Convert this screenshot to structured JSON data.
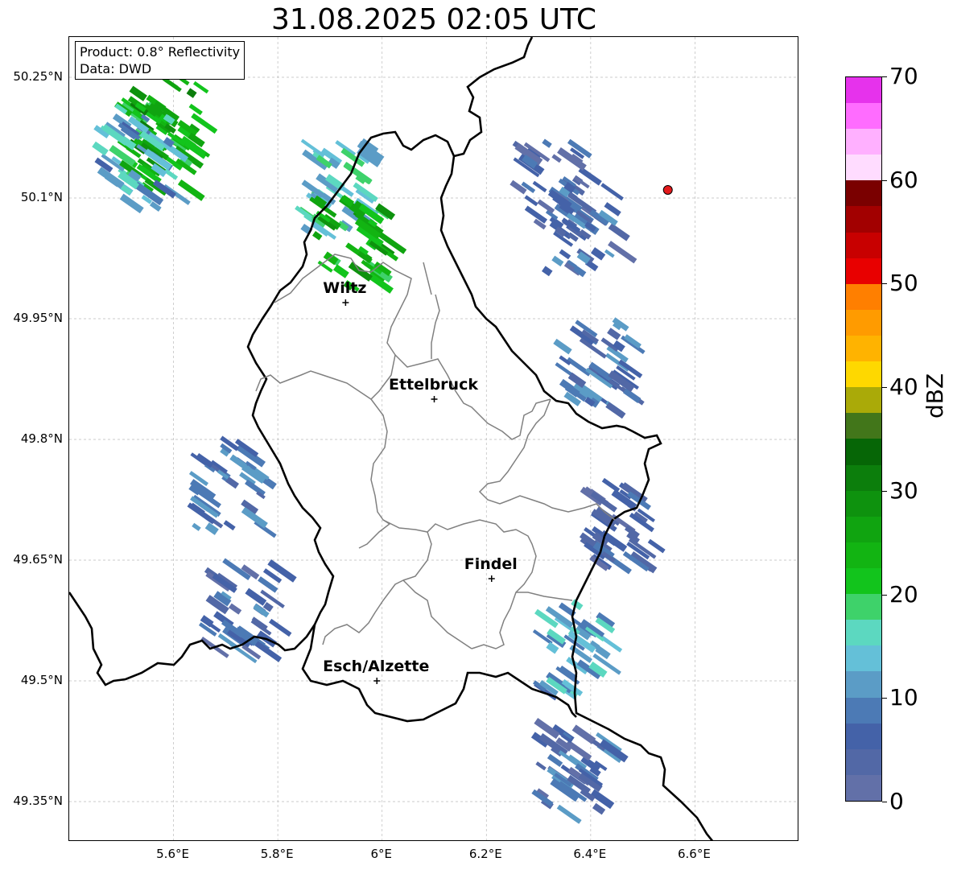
{
  "title": "31.08.2025 02:05 UTC",
  "info": {
    "product": "Product: 0.8° Reflectivity",
    "data": "Data: DWD"
  },
  "map": {
    "lon_range": [
      5.4,
      6.8
    ],
    "lat_range": [
      49.3,
      50.3
    ],
    "lat_ticks": [
      {
        "value": 50.25,
        "label": "50.25°N"
      },
      {
        "value": 50.1,
        "label": "50.1°N"
      },
      {
        "value": 49.95,
        "label": "49.95°N"
      },
      {
        "value": 49.8,
        "label": "49.8°N"
      },
      {
        "value": 49.65,
        "label": "49.65°N"
      },
      {
        "value": 49.5,
        "label": "49.5°N"
      },
      {
        "value": 49.35,
        "label": "49.35°N"
      }
    ],
    "lon_ticks": [
      {
        "value": 5.6,
        "label": "5.6°E"
      },
      {
        "value": 5.8,
        "label": "5.8°E"
      },
      {
        "value": 6.0,
        "label": "6°E"
      },
      {
        "value": 6.2,
        "label": "6.2°E"
      },
      {
        "value": 6.4,
        "label": "6.4°E"
      },
      {
        "value": 6.6,
        "label": "6.6°E"
      }
    ],
    "cities": [
      {
        "name": "Wiltz",
        "lon": 5.93,
        "lat": 49.97
      },
      {
        "name": "Ettelbruck",
        "lon": 6.1,
        "lat": 49.85
      },
      {
        "name": "Findel",
        "lon": 6.21,
        "lat": 49.627
      },
      {
        "name": "Esch/Alzette",
        "lon": 5.99,
        "lat": 49.5
      }
    ],
    "radar_site": {
      "lon": 6.548,
      "lat": 50.11,
      "color": "#e41a1c"
    }
  },
  "colorbar": {
    "unit": "dBZ",
    "min": 0,
    "max": 70,
    "ticks": [
      0,
      10,
      20,
      30,
      40,
      50,
      60,
      70
    ],
    "colors": [
      "#6270a8",
      "#5268a6",
      "#4462a8",
      "#4c7ab5",
      "#5b9cc6",
      "#64c0d8",
      "#5cd8c0",
      "#3ed26a",
      "#12c41c",
      "#12b412",
      "#10a410",
      "#0e920e",
      "#0c7e0c",
      "#066606",
      "#42761a",
      "#aaaa08",
      "#fed800",
      "#ffb300",
      "#ff9b00",
      "#ff7f00",
      "#e80000",
      "#c80000",
      "#a20000",
      "#7a0000",
      "#ffdcff",
      "#ffb0ff",
      "#ff6cff",
      "#e632ec"
    ]
  },
  "radar_cells": [
    {
      "lon": 5.55,
      "lat": 50.17,
      "dbz": 22
    },
    {
      "lon": 5.58,
      "lat": 50.2,
      "dbz": 26
    },
    {
      "lon": 5.52,
      "lat": 50.15,
      "dbz": 12
    },
    {
      "lon": 5.9,
      "lat": 50.12,
      "dbz": 15
    },
    {
      "lon": 5.93,
      "lat": 50.05,
      "dbz": 24
    },
    {
      "lon": 6.32,
      "lat": 50.12,
      "dbz": 5
    },
    {
      "lon": 6.38,
      "lat": 50.07,
      "dbz": 6
    },
    {
      "lon": 6.4,
      "lat": 49.9,
      "dbz": 8
    },
    {
      "lon": 5.7,
      "lat": 49.75,
      "dbz": 8
    },
    {
      "lon": 5.72,
      "lat": 49.6,
      "dbz": 6
    },
    {
      "lon": 6.35,
      "lat": 49.55,
      "dbz": 12
    },
    {
      "lon": 6.36,
      "lat": 49.4,
      "dbz": 6
    },
    {
      "lon": 6.45,
      "lat": 49.7,
      "dbz": 5
    }
  ]
}
